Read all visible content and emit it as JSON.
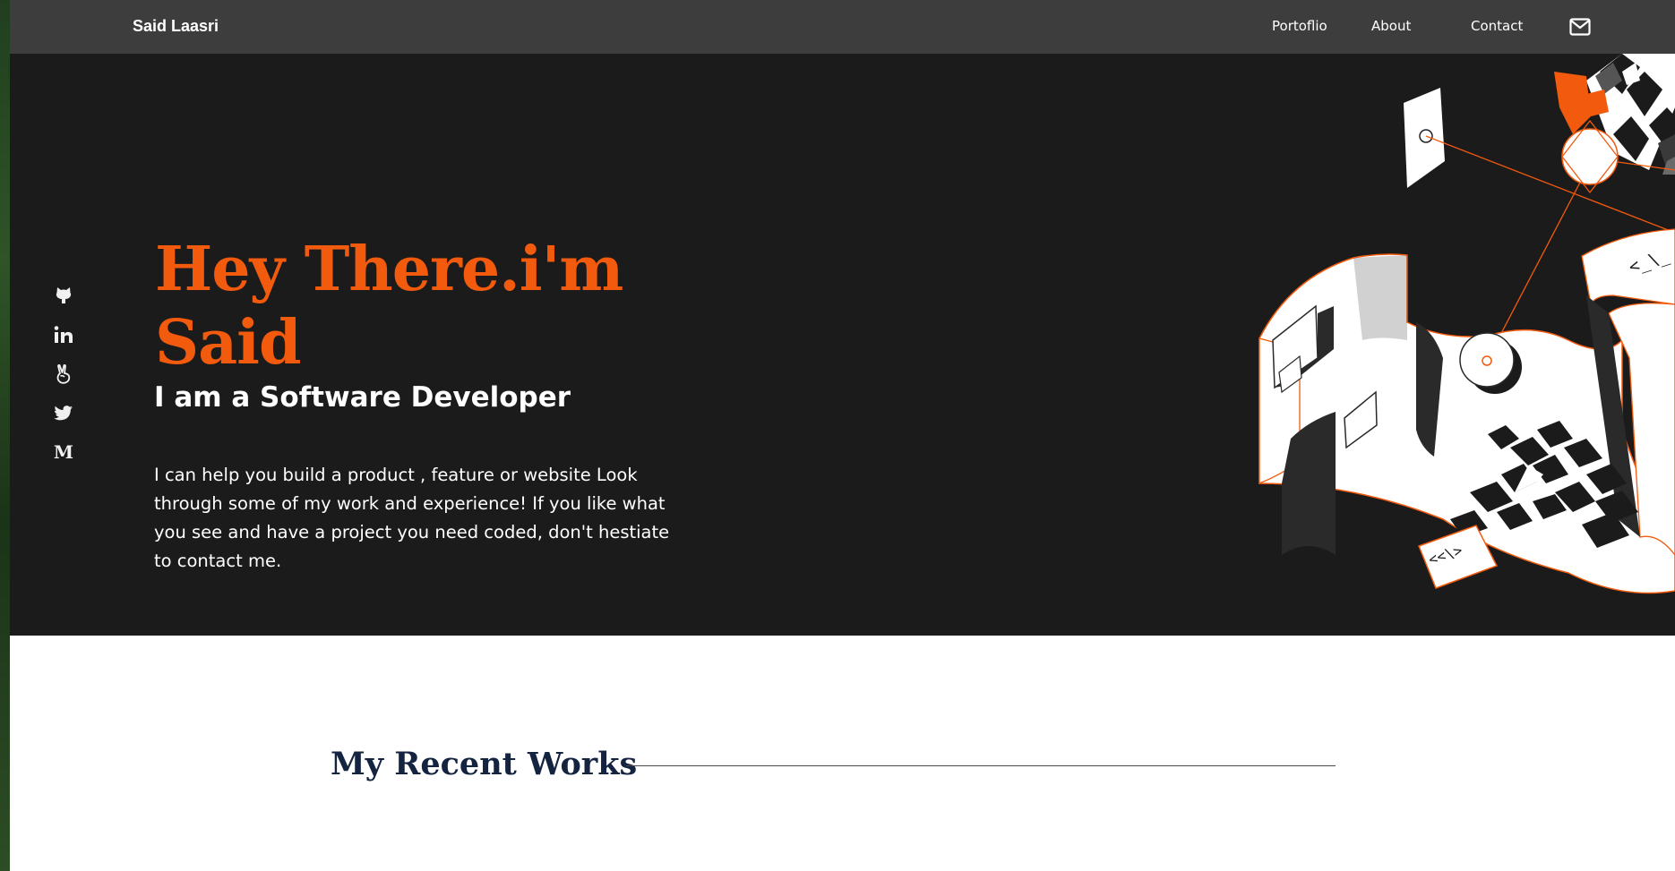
{
  "navbar": {
    "brand": "Said Laasri",
    "links": [
      {
        "label": "Portoflio"
      },
      {
        "label": "About"
      },
      {
        "label": "Contact"
      }
    ],
    "mail_icon": "envelope-icon"
  },
  "social": {
    "icons": [
      "github-icon",
      "linkedin-icon",
      "angellist-icon",
      "twitter-icon",
      "medium-icon"
    ],
    "medium_letter": "M"
  },
  "hero": {
    "title": "Hey There.i'm Said",
    "subtitle": "I am a Software Developer",
    "description": "I can help you build a product , feature or website Look through some of my work and experience! If you like what you see and have a project you need coded, don't hestiate to contact me.",
    "illustration_code_tags": [
      "<_\\_",
      "<<\\>"
    ]
  },
  "works": {
    "title": "My Recent Works"
  },
  "colors": {
    "accent": "#f25a0d",
    "navbar_bg": "#3d3d3d",
    "hero_bg": "#1c1b1b",
    "works_title": "#14233f"
  }
}
